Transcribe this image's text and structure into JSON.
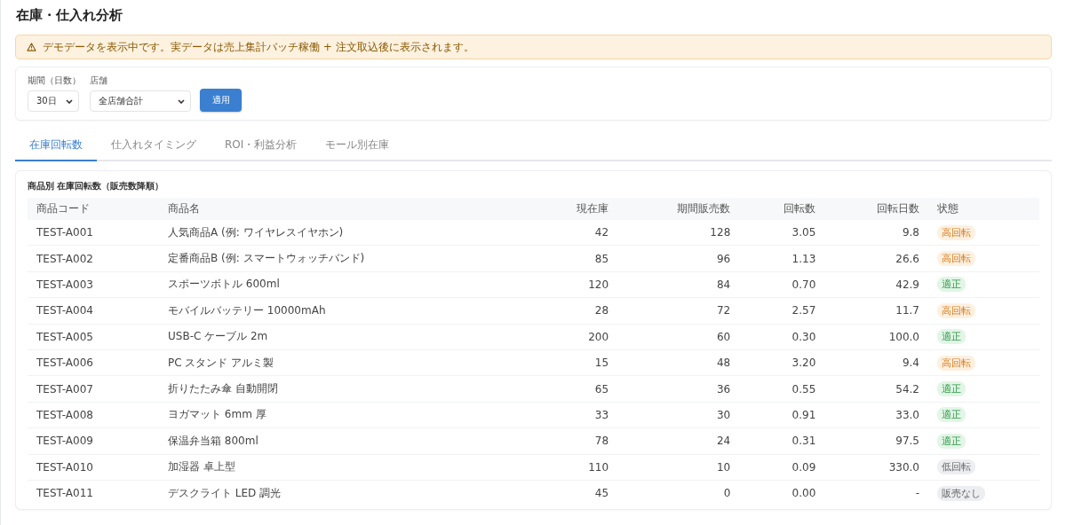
{
  "page_title": "在庫・仕入れ分析",
  "notice": {
    "text": "デモデータを表示中です。実データは売上集計バッチ稼働 + 注文取込後に表示されます。"
  },
  "filters": {
    "period": {
      "label": "期間（日数）",
      "value": "30日"
    },
    "store": {
      "label": "店舗",
      "value": "全店舗合計"
    },
    "apply_button": "適用"
  },
  "tabs": [
    {
      "label": "在庫回転数",
      "selected": true
    },
    {
      "label": "仕入れタイミング",
      "selected": false
    },
    {
      "label": "ROI・利益分析",
      "selected": false
    },
    {
      "label": "モール別在庫",
      "selected": false
    }
  ],
  "table": {
    "title": "商品別 在庫回転数（販売数降順）",
    "columns": [
      "商品コード",
      "商品名",
      "現在庫",
      "期間販売数",
      "回転数",
      "回転日数",
      "状態"
    ],
    "rows": [
      {
        "code": "TEST-A001",
        "name": "人気商品A (例: ワイヤレスイヤホン)",
        "stock": "42",
        "sold": "128",
        "turnover": "3.05",
        "days": "9.8",
        "status": {
          "kind": "high",
          "label": "高回転"
        }
      },
      {
        "code": "TEST-A002",
        "name": "定番商品B (例: スマートウォッチバンド)",
        "stock": "85",
        "sold": "96",
        "turnover": "1.13",
        "days": "26.6",
        "status": {
          "kind": "high",
          "label": "高回転"
        }
      },
      {
        "code": "TEST-A003",
        "name": "スポーツボトル 600ml",
        "stock": "120",
        "sold": "84",
        "turnover": "0.70",
        "days": "42.9",
        "status": {
          "kind": "ok",
          "label": "適正"
        }
      },
      {
        "code": "TEST-A004",
        "name": "モバイルバッテリー 10000mAh",
        "stock": "28",
        "sold": "72",
        "turnover": "2.57",
        "days": "11.7",
        "status": {
          "kind": "high",
          "label": "高回転"
        }
      },
      {
        "code": "TEST-A005",
        "name": "USB-C ケーブル 2m",
        "stock": "200",
        "sold": "60",
        "turnover": "0.30",
        "days": "100.0",
        "status": {
          "kind": "ok",
          "label": "適正"
        }
      },
      {
        "code": "TEST-A006",
        "name": "PC スタンド アルミ製",
        "stock": "15",
        "sold": "48",
        "turnover": "3.20",
        "days": "9.4",
        "status": {
          "kind": "high",
          "label": "高回転"
        }
      },
      {
        "code": "TEST-A007",
        "name": "折りたたみ傘 自動開閉",
        "stock": "65",
        "sold": "36",
        "turnover": "0.55",
        "days": "54.2",
        "status": {
          "kind": "ok",
          "label": "適正"
        }
      },
      {
        "code": "TEST-A008",
        "name": "ヨガマット 6mm 厚",
        "stock": "33",
        "sold": "30",
        "turnover": "0.91",
        "days": "33.0",
        "status": {
          "kind": "ok",
          "label": "適正"
        }
      },
      {
        "code": "TEST-A009",
        "name": "保温弁当箱 800ml",
        "stock": "78",
        "sold": "24",
        "turnover": "0.31",
        "days": "97.5",
        "status": {
          "kind": "ok",
          "label": "適正"
        }
      },
      {
        "code": "TEST-A010",
        "name": "加湿器 卓上型",
        "stock": "110",
        "sold": "10",
        "turnover": "0.09",
        "days": "330.0",
        "status": {
          "kind": "low",
          "label": "低回転"
        }
      },
      {
        "code": "TEST-A011",
        "name": "デスクライト LED 調光",
        "stock": "45",
        "sold": "0",
        "turnover": "0.00",
        "days": "-",
        "status": {
          "kind": "none",
          "label": "販売なし"
        }
      }
    ]
  }
}
